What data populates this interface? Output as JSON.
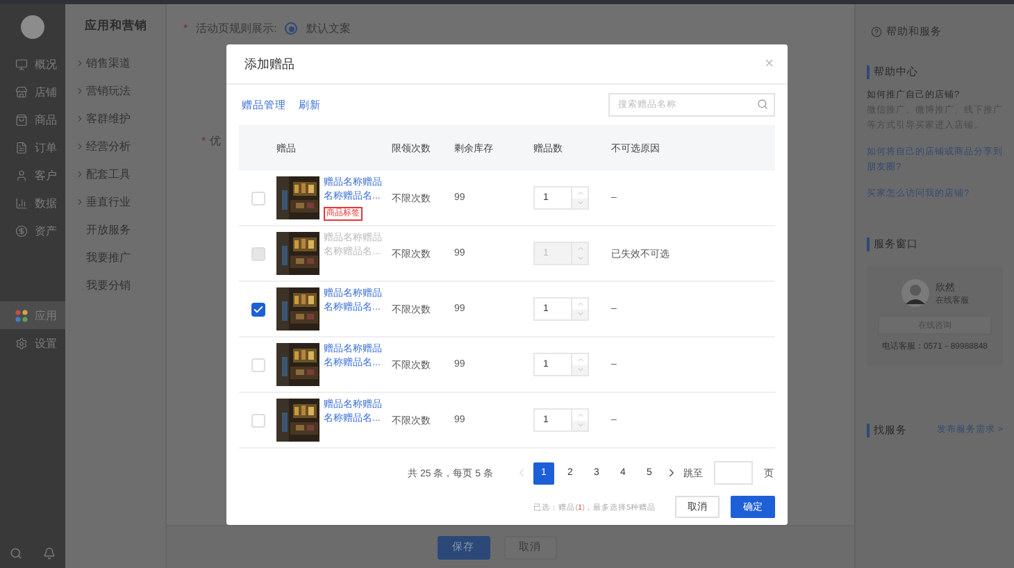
{
  "main_nav": {
    "items": [
      {
        "label": "概况",
        "selected": false
      },
      {
        "label": "店铺",
        "selected": false
      },
      {
        "label": "商品",
        "selected": false
      },
      {
        "label": "订单",
        "selected": false
      },
      {
        "label": "客户",
        "selected": false
      },
      {
        "label": "数据",
        "selected": false
      },
      {
        "label": "资产",
        "selected": false
      },
      {
        "label": "应用",
        "selected": true
      },
      {
        "label": "设置",
        "selected": false
      }
    ]
  },
  "sub_nav": {
    "title": "应用和营销",
    "items": [
      {
        "label": "销售渠道",
        "expandable": true
      },
      {
        "label": "营销玩法",
        "expandable": true
      },
      {
        "label": "客群维护",
        "expandable": true
      },
      {
        "label": "经营分析",
        "expandable": true
      },
      {
        "label": "配套工具",
        "expandable": true
      },
      {
        "label": "垂直行业",
        "expandable": true
      },
      {
        "label": "开放服务",
        "expandable": false
      },
      {
        "label": "我要推广",
        "expandable": false
      },
      {
        "label": "我要分销",
        "expandable": false
      }
    ]
  },
  "form": {
    "required_mark": "*",
    "rule_label": "活动页规则展示:",
    "rule_option": {
      "label": "默认文案",
      "selected": true
    },
    "second_label": "优"
  },
  "footer_buttons": [
    {
      "label": "保存",
      "kind": "primary"
    },
    {
      "label": "取消",
      "kind": "default"
    }
  ],
  "help_panel": {
    "title": "帮助和服务",
    "help_center": "帮助中心",
    "question": "如何推广自己的店铺?",
    "answer": "微信推广、微博推广、线下推广等方式引导买家进入店铺。",
    "links": [
      "如何将自己的店铺或商品分享到朋友圈?",
      "买家怎么访问我的店铺?"
    ],
    "service_title": "服务窗口",
    "agent_name": "欣然",
    "agent_role": "在线客服",
    "consult_button": "在线咨询",
    "phone": "电话客服：0571－89988848",
    "find_service": "找服务",
    "publish_link": "发布服务需求 >"
  },
  "dialog": {
    "title": "添加赠品",
    "close": "×",
    "links": [
      "赠品管理",
      "刷新"
    ],
    "search": {
      "placeholder": "搜索赠品名称"
    },
    "columns": [
      "赠品",
      "限领次数",
      "剩余库存",
      "赠品数",
      "不可选原因"
    ],
    "rows": [
      {
        "selected": false,
        "disabled": false,
        "name": "赠品名称赠品名称赠品名...",
        "tag": "商品标签",
        "limit": "不限次数",
        "stock": "99",
        "quantity": "1",
        "reason": "–"
      },
      {
        "selected": false,
        "disabled": true,
        "name": "赠品名称赠品名称赠品名...",
        "limit": "不限次数",
        "stock": "99",
        "quantity": "1",
        "reason": "已失效不可选"
      },
      {
        "selected": true,
        "disabled": false,
        "name": "赠品名称赠品名称赠品名...",
        "limit": "不限次数",
        "stock": "99",
        "quantity": "1",
        "reason": "–"
      },
      {
        "selected": false,
        "disabled": false,
        "name": "赠品名称赠品名称赠品名...",
        "limit": "不限次数",
        "stock": "99",
        "quantity": "1",
        "reason": "–"
      },
      {
        "selected": false,
        "disabled": false,
        "name": "赠品名称赠品名称赠品名...",
        "limit": "不限次数",
        "stock": "99",
        "quantity": "1",
        "reason": "–"
      }
    ],
    "pagination": {
      "summary": "共 25 条，每页 5 条",
      "pages": [
        {
          "label": "1",
          "selected": true
        },
        {
          "label": "2",
          "selected": false
        },
        {
          "label": "3",
          "selected": false
        },
        {
          "label": "4",
          "selected": false
        },
        {
          "label": "5",
          "selected": false
        }
      ],
      "jump_label": "跳至",
      "page_unit": "页"
    },
    "selection_note": {
      "prefix": "已选：赠品(",
      "count": "1",
      "suffix": ")，最多选择5种赠品"
    },
    "buttons": [
      {
        "label": "取消",
        "kind": "default"
      },
      {
        "label": "确定",
        "kind": "primary"
      }
    ]
  }
}
